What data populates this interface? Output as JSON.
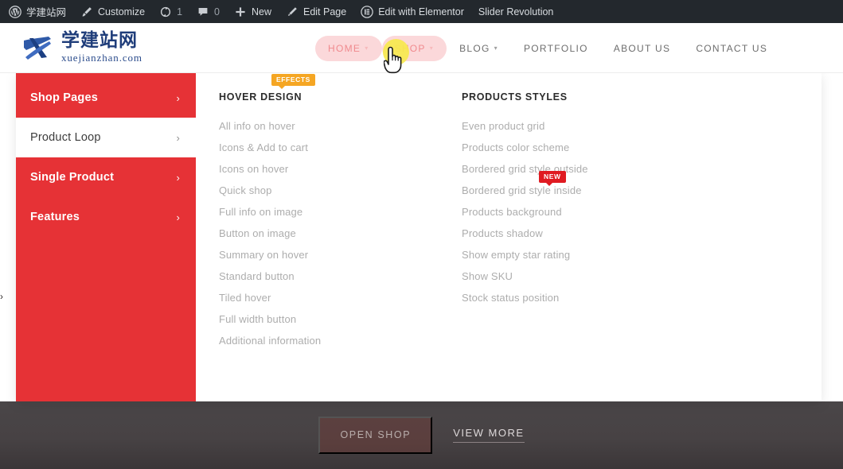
{
  "adminbar": {
    "items": [
      {
        "icon": "wordpress-icon",
        "label": "学建站网",
        "count": ""
      },
      {
        "icon": "brush-icon",
        "label": "Customize",
        "count": ""
      },
      {
        "icon": "updates-icon",
        "label": "",
        "count": "1"
      },
      {
        "icon": "comments-icon",
        "label": "",
        "count": "0"
      },
      {
        "icon": "plus-icon",
        "label": "New",
        "count": ""
      },
      {
        "icon": "pencil-icon",
        "label": "Edit Page",
        "count": ""
      },
      {
        "icon": "elementor-icon",
        "label": "Edit with Elementor",
        "count": ""
      },
      {
        "icon": "",
        "label": "Slider Revolution",
        "count": ""
      }
    ]
  },
  "header": {
    "logo": {
      "name_cn": "学建站网",
      "domain": "xuejianzhan.com"
    },
    "nav": [
      {
        "label": "HOME",
        "caret": "▾",
        "active": true
      },
      {
        "label": "SHOP",
        "caret": "▾",
        "active": true
      },
      {
        "label": "BLOG",
        "caret": "▾",
        "active": false
      },
      {
        "label": "PORTFOLIO",
        "caret": "",
        "active": false
      },
      {
        "label": "ABOUT US",
        "caret": "",
        "active": false
      },
      {
        "label": "CONTACT US",
        "caret": "",
        "active": false
      }
    ]
  },
  "megamenu": {
    "sidebar": [
      {
        "label": "Shop Pages",
        "chevron": "›",
        "active": false
      },
      {
        "label": "Product Loop",
        "chevron": "›",
        "active": true
      },
      {
        "label": "Single Product",
        "chevron": "›",
        "active": false
      },
      {
        "label": "Features",
        "chevron": "›",
        "active": false
      }
    ],
    "columns": [
      {
        "title": "HOVER DESIGN",
        "badge": {
          "text": "EFFECTS",
          "color": "#f5a623"
        },
        "links": [
          "All info on hover",
          "Icons & Add to cart",
          "Icons on hover",
          "Quick shop",
          "Full info on image",
          "Button on image",
          "Summary on hover",
          "Standard button",
          "Tiled hover",
          "Full width button",
          "Additional information"
        ]
      },
      {
        "title": "PRODUCTS STYLES",
        "badge": {
          "text": "NEW",
          "color": "#e01b22"
        },
        "links": [
          "Even product grid",
          "Products color scheme",
          "Bordered grid style outside",
          "Bordered grid style inside",
          "Products background",
          "Products shadow",
          "Show empty star rating",
          "Show SKU",
          "Stock status position"
        ]
      }
    ]
  },
  "hero": {
    "open_shop_label": "OPEN SHOP",
    "view_more_label": "VIEW MORE"
  },
  "colors": {
    "brand_red": "#e63236",
    "adminbar_bg": "#23282d",
    "badge_orange": "#f5a623",
    "badge_red": "#e01b22",
    "nav_pill": "#fbd8da",
    "cursor_glow": "#f7e94e"
  }
}
